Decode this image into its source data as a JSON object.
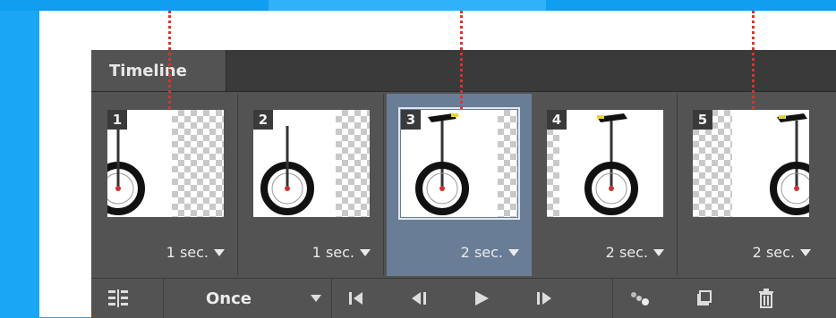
{
  "panel": {
    "tab_title": "Timeline"
  },
  "frames": [
    {
      "number": "1",
      "duration": "1 sec.",
      "selected": false
    },
    {
      "number": "2",
      "duration": "1 sec.",
      "selected": false
    },
    {
      "number": "3",
      "duration": "2 sec.",
      "selected": true
    },
    {
      "number": "4",
      "duration": "2 sec.",
      "selected": false
    },
    {
      "number": "5",
      "duration": "2 sec.",
      "selected": false
    }
  ],
  "toolbar": {
    "loop_option": "Once",
    "icons": [
      "panel-options-icon",
      "chevron-down-icon",
      "first-frame-icon",
      "previous-frame-icon",
      "play-icon",
      "next-frame-icon",
      "tween-icon",
      "duplicate-frame-icon",
      "delete-icon"
    ]
  },
  "colors": {
    "background": "#1aa6f5",
    "panel": "#535353",
    "selected_frame": "#697d96",
    "guide_line": "#e0312b"
  }
}
